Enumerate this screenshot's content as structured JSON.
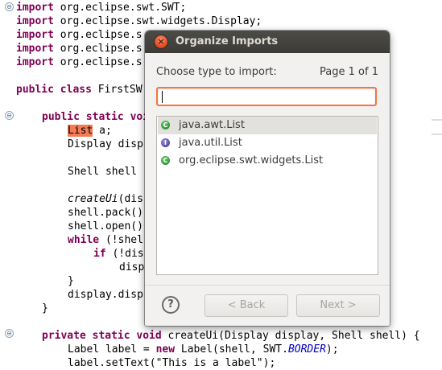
{
  "editor": {
    "lines": {
      "l1": {
        "kw": "import",
        "rest": " org.eclipse.swt.SWT;"
      },
      "l2": {
        "kw": "import",
        "rest": " org.eclipse.swt.widgets.Display;"
      },
      "l3": {
        "kw": "import",
        "rest": " org.eclipse.s"
      },
      "l4": {
        "kw": "import",
        "rest": " org.eclipse.s"
      },
      "l5": {
        "kw": "import",
        "rest": " org.eclipse.s"
      },
      "l6": {
        "kw": "public class",
        "rest": " FirstSW"
      },
      "l7": {
        "kw": "public static voi",
        "rest": ""
      },
      "l8": {
        "hl": "List",
        "rest": " a;"
      },
      "l9": {
        "rest": "Display disp"
      },
      "l10": {
        "rest": "Shell shell"
      },
      "l11": {
        "it": "createUi",
        "rest": "(dis"
      },
      "l12": {
        "rest": "shell.pack()"
      },
      "l13": {
        "rest": "shell.open()"
      },
      "l14": {
        "kw": "while",
        "rest": " (!shel"
      },
      "l15": {
        "kw": "if",
        "rest": " (!dis"
      },
      "l16": {
        "rest": "disp"
      },
      "l17": {
        "rest": "}"
      },
      "l18": {
        "rest": "display.disp"
      },
      "l19": {
        "rest": "}"
      },
      "l20": {
        "kw": "private static void",
        "rest": " createUi(Display display, Shell shell) {"
      },
      "l21": {
        "pre": "Label label = ",
        "kw": "new",
        "mid": " Label(shell, SWT.",
        "const": "BORDER",
        "post": ");"
      },
      "l22": {
        "rest": "label.setText(\"This is a label\");"
      }
    },
    "gutter_symbol": "⊖"
  },
  "dialog": {
    "title": "Organize Imports",
    "close_symbol": "×",
    "prompt": "Choose type to import:",
    "page": "Page 1 of 1",
    "search": {
      "value": "",
      "placeholder": ""
    },
    "items": [
      {
        "label": "java.awt.List",
        "icon": "class-icon",
        "selected": true
      },
      {
        "label": "java.util.List",
        "icon": "interface-icon",
        "selected": false
      },
      {
        "label": "org.eclipse.swt.widgets.List",
        "icon": "class-icon",
        "selected": false
      }
    ],
    "help_symbol": "?",
    "back_label": "< Back",
    "next_label": "Next >"
  }
}
